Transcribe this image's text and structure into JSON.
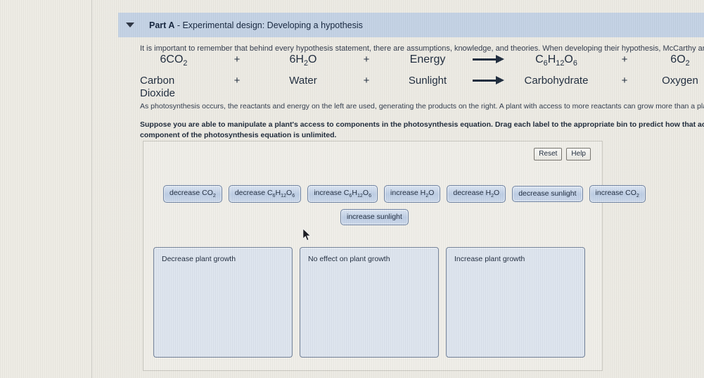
{
  "part_header": {
    "disclosure_icon": "triangle-down-icon",
    "label_bold": "Part A",
    "label_rest": " - Experimental design: Developing a hypothesis"
  },
  "intro": {
    "text": "It is important to remember that behind every hypothesis statement, there are assumptions, knowledge, and theories. When developing their hypothesis, McCarthy and her colleague"
  },
  "equation": {
    "formula": {
      "reactant1": "6CO2",
      "plus1": "+",
      "reactant2": "6H2O",
      "plus2": "+",
      "reactant3": "Energy",
      "arrow": "arrow-right-icon",
      "product1": "C6H12O6",
      "plus3": "+",
      "product2": "6O2"
    },
    "words": {
      "reactant1_line1": "Carbon",
      "reactant1_line2": "Dioxide",
      "plus1": "+",
      "reactant2": "Water",
      "plus2": "+",
      "reactant3": "Sunlight",
      "arrow": "arrow-right-icon",
      "product1": "Carbohydrate",
      "plus3": "+",
      "product2": "Oxygen"
    }
  },
  "paragraphs": {
    "normal": "As photosynthesis occurs, the reactants and energy on the left are used, generating the products on the right. A plant with access to more reactants can grow more than a plant with",
    "bold_line1": "Suppose you are able to manipulate a plant's access to  components in the photosynthesis equation. Drag each label to the appropriate bin to predict how that action w",
    "bold_line2": "component of the photosynthesis equation is unlimited."
  },
  "toolbar": {
    "reset_label": "Reset",
    "help_label": "Help"
  },
  "labels": {
    "row1": [
      {
        "text_before": "decrease CO",
        "sub": "2",
        "text_after": ""
      },
      {
        "text_before": "decrease C",
        "sub": "6",
        "text_after": "H12O6"
      },
      {
        "text_before": "increase C",
        "sub": "6",
        "text_after": "H12O6"
      },
      {
        "text_before": "increase H",
        "sub": "2",
        "text_after": "O"
      },
      {
        "text_before": "decrease H",
        "sub": "2",
        "text_after": "O"
      },
      {
        "text_before": "decrease sunlight",
        "sub": "",
        "text_after": ""
      },
      {
        "text_before": "increase CO",
        "sub": "2",
        "text_after": ""
      }
    ],
    "row2": [
      {
        "text_before": "increase sunlight",
        "sub": "",
        "text_after": ""
      }
    ],
    "plain": [
      "decrease CO2",
      "decrease C6H12O6",
      "increase C6H12O6",
      "increase H2O",
      "decrease H2O",
      "decrease sunlight",
      "increase CO2",
      "increase sunlight"
    ]
  },
  "bins": [
    {
      "label": "Decrease plant growth"
    },
    {
      "label": "No effect on plant growth"
    },
    {
      "label": "Increase plant growth"
    }
  ],
  "cursor": {
    "icon": "mouse-pointer-icon"
  },
  "colors": {
    "page_background": "#ebe9e2",
    "header_bar": "#c3d2e4",
    "chip_border": "#6a7fa0",
    "bin_fill": "#dde4ee",
    "bin_border": "#6f7f97",
    "text": "#1d2a3c"
  }
}
